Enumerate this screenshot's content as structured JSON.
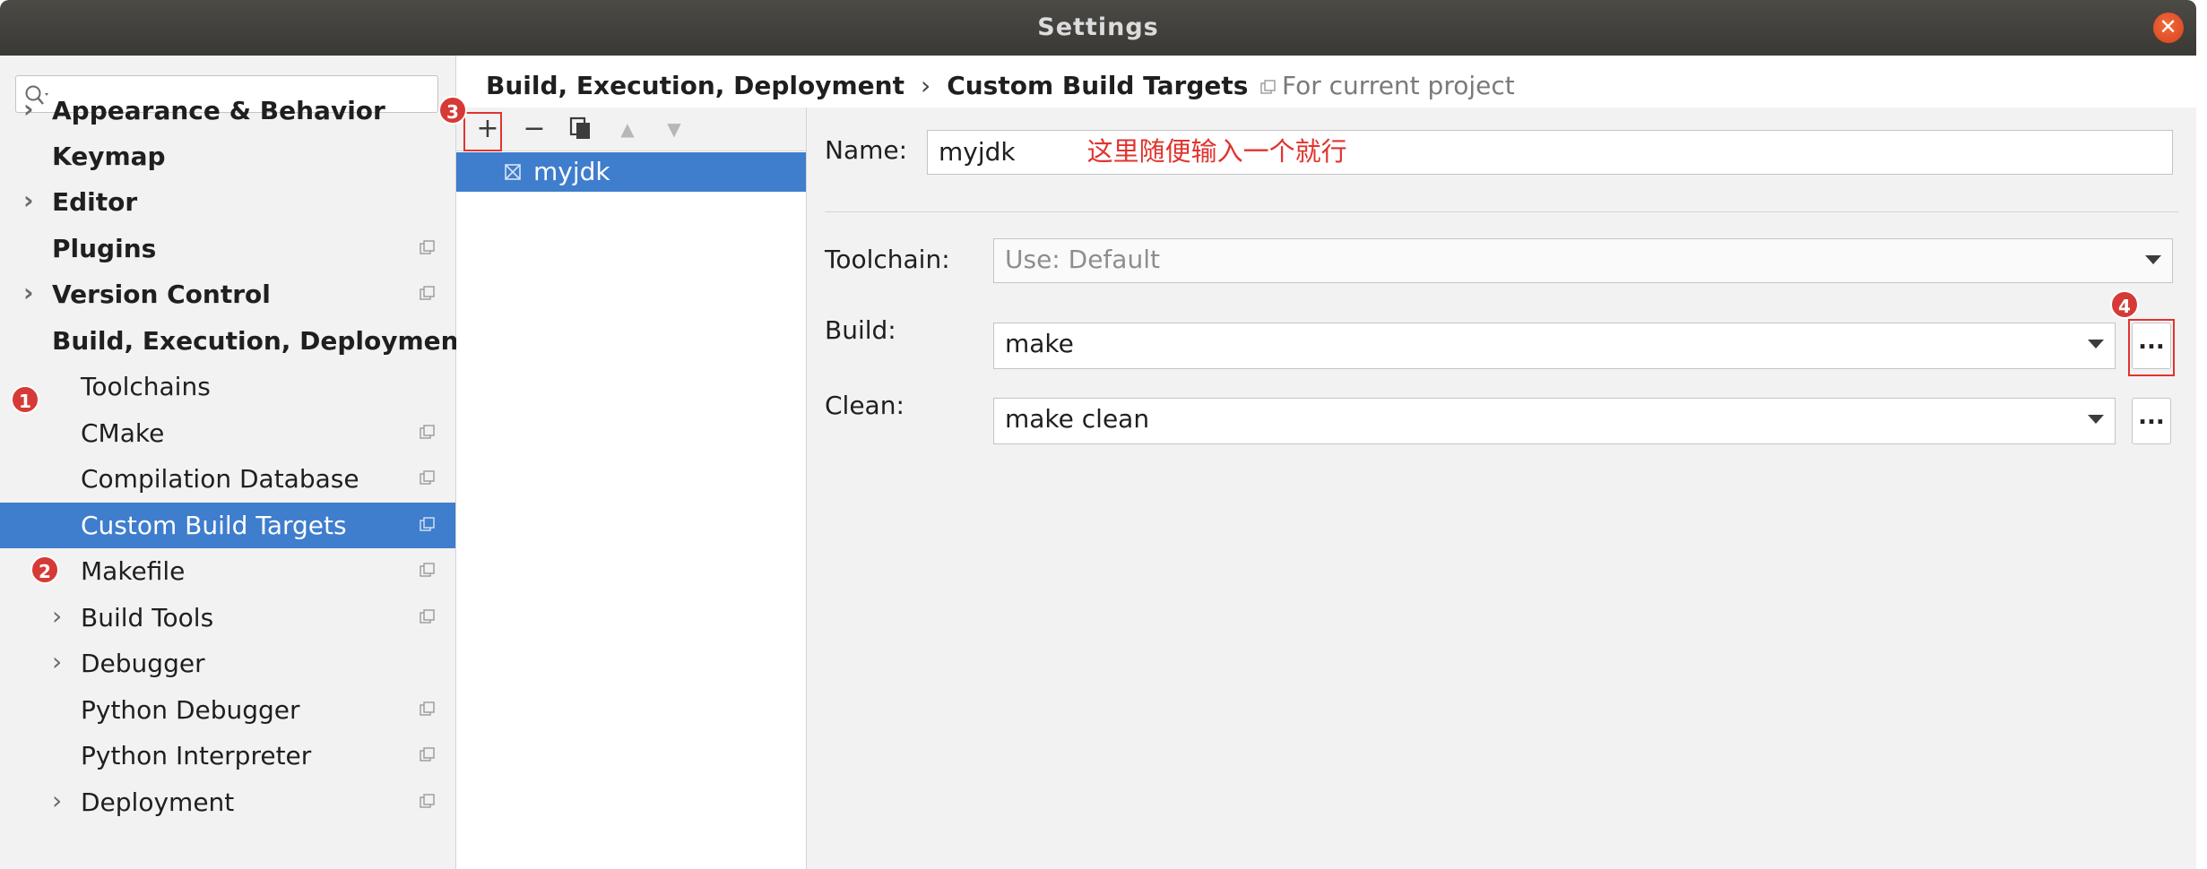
{
  "window": {
    "title": "Settings",
    "close_glyph": "✕"
  },
  "search": {
    "placeholder": "",
    "icon": "search-icon"
  },
  "tree": {
    "items": [
      {
        "label": "Appearance & Behavior",
        "expand": "›"
      },
      {
        "label": "Keymap"
      },
      {
        "label": "Editor",
        "expand": "›"
      },
      {
        "label": "Plugins"
      },
      {
        "label": "Version Control",
        "expand": "›"
      },
      {
        "label": "Build, Execution, Deployment"
      },
      {
        "label": "Toolchains"
      },
      {
        "label": "CMake"
      },
      {
        "label": "Compilation Database"
      },
      {
        "label": "Custom Build Targets"
      },
      {
        "label": "Makefile"
      },
      {
        "label": "Build Tools",
        "expand": "›"
      },
      {
        "label": "Debugger",
        "expand": "›"
      },
      {
        "label": "Python Debugger"
      },
      {
        "label": "Python Interpreter"
      },
      {
        "label": "Deployment",
        "expand": "›"
      }
    ]
  },
  "breadcrumb": {
    "parent": "Build, Execution, Deployment",
    "separator": "›",
    "current": "Custom Build Targets",
    "scope": "For current project"
  },
  "toolbar": {
    "add": "+",
    "remove": "−",
    "up": "▲",
    "down": "▼"
  },
  "targets": {
    "items": [
      {
        "name": "myjdk"
      }
    ]
  },
  "form": {
    "name_label": "Name:",
    "name_value": "myjdk",
    "name_note": "这里随便输入一个就行",
    "toolchain_label": "Toolchain:",
    "toolchain_value": "Use: Default",
    "build_label": "Build:",
    "build_value": "make",
    "clean_label": "Clean:",
    "clean_value": "make clean",
    "browse_label": "..."
  },
  "annotations": {
    "b1": "1",
    "b2": "2",
    "b3": "3",
    "b4": "4"
  },
  "colors": {
    "selection": "#3f7dcd",
    "annotation_red": "#e0342f",
    "titlebar": "#3d3c38"
  }
}
